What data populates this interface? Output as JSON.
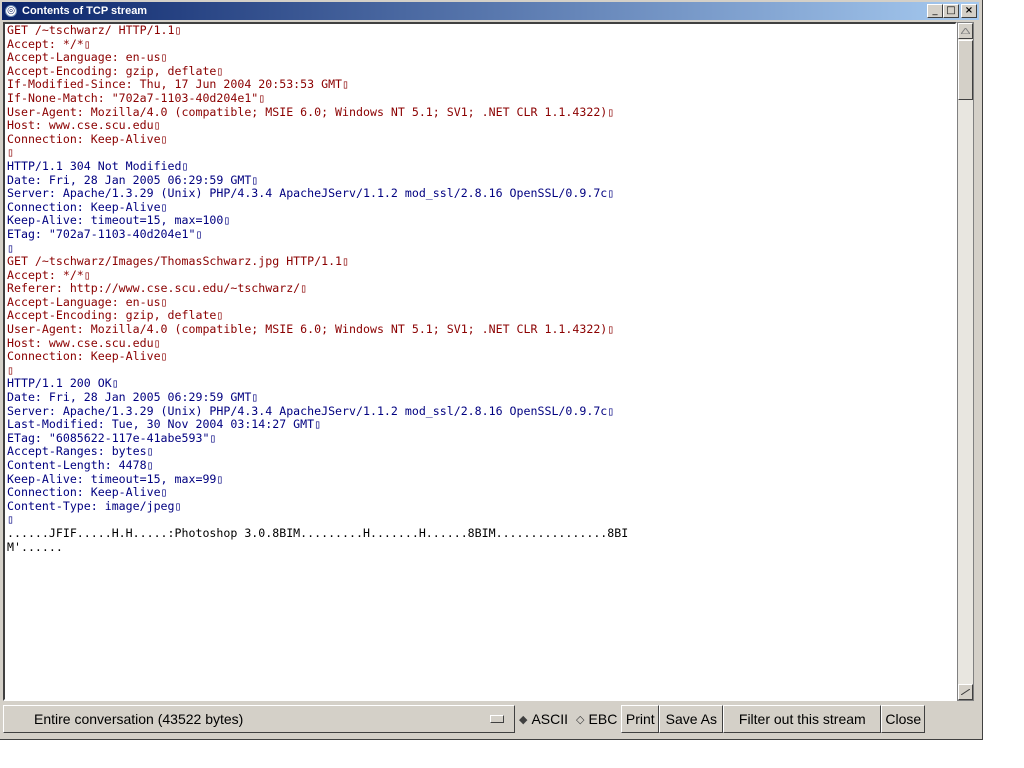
{
  "window": {
    "title": "Contents of TCP stream",
    "controls": {
      "minimize": "_",
      "maximize": "□",
      "close": "×"
    }
  },
  "stream_lines": [
    {
      "dir": "client",
      "text": "GET /~tschwarz/ HTTP/1.1▯"
    },
    {
      "dir": "client",
      "text": "Accept: */*▯"
    },
    {
      "dir": "client",
      "text": "Accept-Language: en-us▯"
    },
    {
      "dir": "client",
      "text": "Accept-Encoding: gzip, deflate▯"
    },
    {
      "dir": "client",
      "text": "If-Modified-Since: Thu, 17 Jun 2004 20:53:53 GMT▯"
    },
    {
      "dir": "client",
      "text": "If-None-Match: \"702a7-1103-40d204e1\"▯"
    },
    {
      "dir": "client",
      "text": "User-Agent: Mozilla/4.0 (compatible; MSIE 6.0; Windows NT 5.1; SV1; .NET CLR 1.1.4322)▯"
    },
    {
      "dir": "client",
      "text": "Host: www.cse.scu.edu▯"
    },
    {
      "dir": "client",
      "text": "Connection: Keep-Alive▯"
    },
    {
      "dir": "client",
      "text": "▯"
    },
    {
      "dir": "server",
      "text": "HTTP/1.1 304 Not Modified▯"
    },
    {
      "dir": "server",
      "text": "Date: Fri, 28 Jan 2005 06:29:59 GMT▯"
    },
    {
      "dir": "server",
      "text": "Server: Apache/1.3.29 (Unix) PHP/4.3.4 ApacheJServ/1.1.2 mod_ssl/2.8.16 OpenSSL/0.9.7c▯"
    },
    {
      "dir": "server",
      "text": "Connection: Keep-Alive▯"
    },
    {
      "dir": "server",
      "text": "Keep-Alive: timeout=15, max=100▯"
    },
    {
      "dir": "server",
      "text": "ETag: \"702a7-1103-40d204e1\"▯"
    },
    {
      "dir": "server",
      "text": "▯"
    },
    {
      "dir": "client",
      "text": "GET /~tschwarz/Images/ThomasSchwarz.jpg HTTP/1.1▯"
    },
    {
      "dir": "client",
      "text": "Accept: */*▯"
    },
    {
      "dir": "client",
      "text": "Referer: http://www.cse.scu.edu/~tschwarz/▯"
    },
    {
      "dir": "client",
      "text": "Accept-Language: en-us▯"
    },
    {
      "dir": "client",
      "text": "Accept-Encoding: gzip, deflate▯"
    },
    {
      "dir": "client",
      "text": "User-Agent: Mozilla/4.0 (compatible; MSIE 6.0; Windows NT 5.1; SV1; .NET CLR 1.1.4322)▯"
    },
    {
      "dir": "client",
      "text": "Host: www.cse.scu.edu▯"
    },
    {
      "dir": "client",
      "text": "Connection: Keep-Alive▯"
    },
    {
      "dir": "client",
      "text": "▯"
    },
    {
      "dir": "server",
      "text": "HTTP/1.1 200 OK▯"
    },
    {
      "dir": "server",
      "text": "Date: Fri, 28 Jan 2005 06:29:59 GMT▯"
    },
    {
      "dir": "server",
      "text": "Server: Apache/1.3.29 (Unix) PHP/4.3.4 ApacheJServ/1.1.2 mod_ssl/2.8.16 OpenSSL/0.9.7c▯"
    },
    {
      "dir": "server",
      "text": "Last-Modified: Tue, 30 Nov 2004 03:14:27 GMT▯"
    },
    {
      "dir": "server",
      "text": "ETag: \"6085622-117e-41abe593\"▯"
    },
    {
      "dir": "server",
      "text": "Accept-Ranges: bytes▯"
    },
    {
      "dir": "server",
      "text": "Content-Length: 4478▯"
    },
    {
      "dir": "server",
      "text": "Keep-Alive: timeout=15, max=99▯"
    },
    {
      "dir": "server",
      "text": "Connection: Keep-Alive▯"
    },
    {
      "dir": "server",
      "text": "Content-Type: image/jpeg▯"
    },
    {
      "dir": "server",
      "text": "▯"
    },
    {
      "dir": "raw",
      "text": "......JFIF.....H.H.....:Photoshop 3.0.8BIM.........H.......H......8BIM................8BI"
    },
    {
      "dir": "raw",
      "text": "M'......"
    }
  ],
  "colors": {
    "client_text": "#8b0000",
    "server_text": "#000080",
    "title_bar": "#0a246a"
  },
  "bottom": {
    "conversation_select": "Entire conversation (43522 bytes)",
    "radio_ascii": "ASCII",
    "radio_ebcdic": "EBC",
    "print_button": "Print",
    "save_as_button": "Save As",
    "filter_button": "Filter out this stream",
    "close_button": "Close"
  }
}
